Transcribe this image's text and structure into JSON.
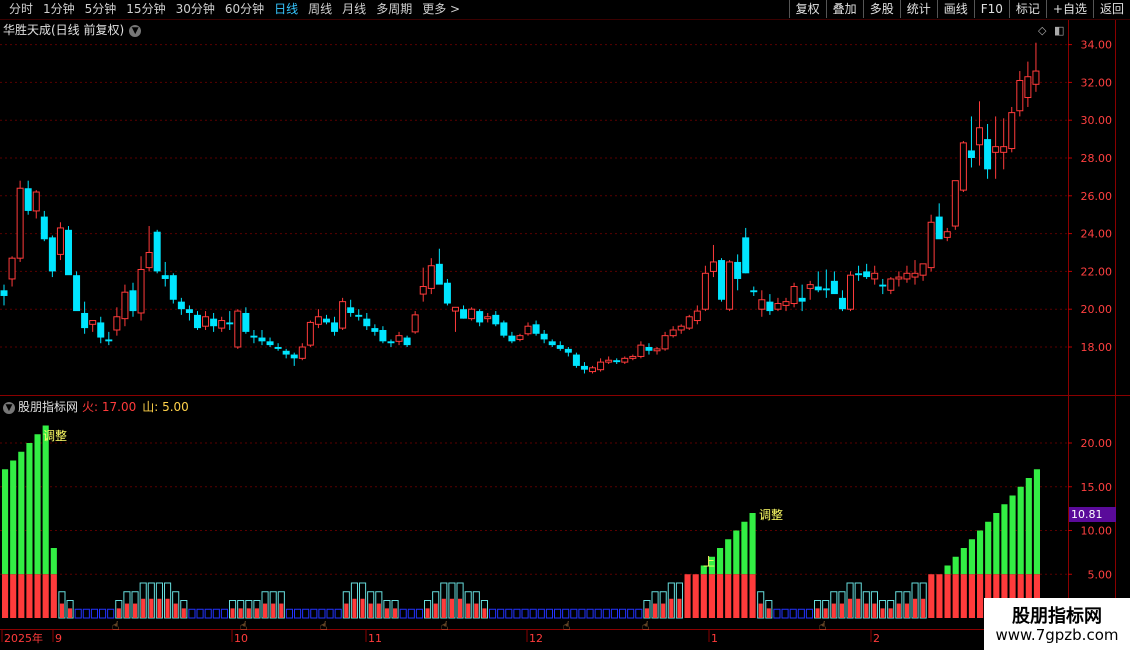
{
  "toolbar": {
    "tabs": [
      "分时",
      "1分钟",
      "5分钟",
      "15分钟",
      "30分钟",
      "60分钟",
      "日线",
      "周线",
      "月线",
      "多周期",
      "更多 >"
    ],
    "active_tab": "日线",
    "buttons": [
      "复权",
      "叠加",
      "多股",
      "统计",
      "画线",
      "F10",
      "标记",
      "+自选",
      "返回"
    ]
  },
  "chart_title": "华胜天成(日线 前复权)",
  "indicator": {
    "name": "股朋指标网",
    "param1": "火: 17.00",
    "param2": "山: 5.00",
    "labels": {
      "adjust1": "调整",
      "adjust2": "调整",
      "up": "上"
    },
    "current_value": "10.81"
  },
  "price_axis": [
    "34.00",
    "32.00",
    "30.00",
    "28.00",
    "26.00",
    "24.00",
    "22.00",
    "20.00",
    "18.00"
  ],
  "ind_axis": [
    "20.00",
    "15.00",
    "10.00",
    "5.00"
  ],
  "date_axis": [
    "2025年",
    "9",
    "10",
    "11",
    "12",
    "1",
    "2"
  ],
  "watermark": {
    "line1": "股朋指标网",
    "line2": "www.7gpzb.com"
  },
  "colors": {
    "up": "#ff3b3b",
    "down": "#00e5ff",
    "green": "#33ee44",
    "blue": "#2233ff"
  },
  "chart_data": {
    "type": "candlestick",
    "title": "华胜天成(日线 前复权)",
    "ylim": [
      16,
      35
    ],
    "candles": [
      [
        21.0,
        21.3,
        20.2,
        20.7
      ],
      [
        21.6,
        22.8,
        21.2,
        22.7
      ],
      [
        22.7,
        26.8,
        22.5,
        26.4
      ],
      [
        26.4,
        26.8,
        25.0,
        25.2
      ],
      [
        25.2,
        26.3,
        24.8,
        26.2
      ],
      [
        24.9,
        25.2,
        23.6,
        23.7
      ],
      [
        23.8,
        23.9,
        21.7,
        22.0
      ],
      [
        22.9,
        24.6,
        22.6,
        24.3
      ],
      [
        24.2,
        24.4,
        21.9,
        21.8
      ],
      [
        21.8,
        22.0,
        20.0,
        19.9
      ],
      [
        19.8,
        20.4,
        18.7,
        19.0
      ],
      [
        19.2,
        19.4,
        18.8,
        19.4
      ],
      [
        19.3,
        19.6,
        18.2,
        18.5
      ],
      [
        18.4,
        18.8,
        18.1,
        18.3
      ],
      [
        18.9,
        20.1,
        18.6,
        19.6
      ],
      [
        19.5,
        21.3,
        19.1,
        20.9
      ],
      [
        21.0,
        21.4,
        19.6,
        19.9
      ],
      [
        19.8,
        22.8,
        19.4,
        22.1
      ],
      [
        22.2,
        24.4,
        22.0,
        23.0
      ],
      [
        24.1,
        24.2,
        21.9,
        22.0
      ],
      [
        21.8,
        22.5,
        21.2,
        21.6
      ],
      [
        21.8,
        21.9,
        20.3,
        20.5
      ],
      [
        20.4,
        20.6,
        19.7,
        20.0
      ],
      [
        20.0,
        20.2,
        19.4,
        19.8
      ],
      [
        19.7,
        19.9,
        18.9,
        19.0
      ],
      [
        19.1,
        19.9,
        18.9,
        19.6
      ],
      [
        19.5,
        19.8,
        18.8,
        19.1
      ],
      [
        19.0,
        19.6,
        18.8,
        19.4
      ],
      [
        19.3,
        19.9,
        18.9,
        19.2
      ],
      [
        18.0,
        20.0,
        17.9,
        19.9
      ],
      [
        19.8,
        20.1,
        18.7,
        18.8
      ],
      [
        18.6,
        18.9,
        18.2,
        18.5
      ],
      [
        18.5,
        18.9,
        18.1,
        18.3
      ],
      [
        18.3,
        18.5,
        18.0,
        18.1
      ],
      [
        18.0,
        18.2,
        17.8,
        17.9
      ],
      [
        17.8,
        17.9,
        17.4,
        17.6
      ],
      [
        17.6,
        17.7,
        17.0,
        17.4
      ],
      [
        17.4,
        18.2,
        17.3,
        18.0
      ],
      [
        18.1,
        19.4,
        18.0,
        19.3
      ],
      [
        19.2,
        20.0,
        19.0,
        19.6
      ],
      [
        19.5,
        19.7,
        19.2,
        19.3
      ],
      [
        19.3,
        19.6,
        18.6,
        18.8
      ],
      [
        19.0,
        20.6,
        18.9,
        20.4
      ],
      [
        20.1,
        20.5,
        19.6,
        19.8
      ],
      [
        19.7,
        20.0,
        19.4,
        19.6
      ],
      [
        19.5,
        19.8,
        18.9,
        19.1
      ],
      [
        19.0,
        19.2,
        18.6,
        18.8
      ],
      [
        18.9,
        19.1,
        18.2,
        18.3
      ],
      [
        18.3,
        18.4,
        18.0,
        18.2
      ],
      [
        18.3,
        18.8,
        18.1,
        18.6
      ],
      [
        18.5,
        18.6,
        18.0,
        18.1
      ],
      [
        18.8,
        19.9,
        18.7,
        19.7
      ],
      [
        20.8,
        22.2,
        20.4,
        21.2
      ],
      [
        21.1,
        22.7,
        20.8,
        22.3
      ],
      [
        22.4,
        23.2,
        22.0,
        21.3
      ],
      [
        21.4,
        21.6,
        20.2,
        20.3
      ],
      [
        19.9,
        20.0,
        18.8,
        20.1
      ],
      [
        20.0,
        20.2,
        19.5,
        19.5
      ],
      [
        19.5,
        20.1,
        19.4,
        20.0
      ],
      [
        19.9,
        20.0,
        19.1,
        19.3
      ],
      [
        19.5,
        19.8,
        19.3,
        19.6
      ],
      [
        19.7,
        19.9,
        19.1,
        19.2
      ],
      [
        19.3,
        19.4,
        18.5,
        18.6
      ],
      [
        18.6,
        18.8,
        18.2,
        18.3
      ],
      [
        18.4,
        18.7,
        18.3,
        18.6
      ],
      [
        18.7,
        19.3,
        18.6,
        19.1
      ],
      [
        19.2,
        19.4,
        18.6,
        18.7
      ],
      [
        18.7,
        18.9,
        18.2,
        18.4
      ],
      [
        18.3,
        18.4,
        18.0,
        18.1
      ],
      [
        18.1,
        18.3,
        17.8,
        17.9
      ],
      [
        17.9,
        18.0,
        17.5,
        17.7
      ],
      [
        17.6,
        17.7,
        16.9,
        17.0
      ],
      [
        17.0,
        17.2,
        16.6,
        16.8
      ],
      [
        16.7,
        17.0,
        16.6,
        16.9
      ],
      [
        16.8,
        17.4,
        16.7,
        17.2
      ],
      [
        17.2,
        17.5,
        17.1,
        17.3
      ],
      [
        17.3,
        17.4,
        17.1,
        17.2
      ],
      [
        17.2,
        17.5,
        17.1,
        17.4
      ],
      [
        17.4,
        17.6,
        17.3,
        17.5
      ],
      [
        17.5,
        18.3,
        17.4,
        18.1
      ],
      [
        18.0,
        18.2,
        17.6,
        17.8
      ],
      [
        17.8,
        18.0,
        17.6,
        17.9
      ],
      [
        17.9,
        18.8,
        17.8,
        18.6
      ],
      [
        18.6,
        19.1,
        18.5,
        18.9
      ],
      [
        18.9,
        19.2,
        18.7,
        19.1
      ],
      [
        19.0,
        19.7,
        18.9,
        19.6
      ],
      [
        19.4,
        20.2,
        19.2,
        19.9
      ],
      [
        20.0,
        22.3,
        19.9,
        21.9
      ],
      [
        22.0,
        23.4,
        21.7,
        22.5
      ],
      [
        22.6,
        22.7,
        20.4,
        20.5
      ],
      [
        20.0,
        22.6,
        19.9,
        22.5
      ],
      [
        22.5,
        22.9,
        21.0,
        21.6
      ],
      [
        23.8,
        24.3,
        21.9,
        21.9
      ],
      [
        21.0,
        21.2,
        20.7,
        20.9
      ],
      [
        20.0,
        21.0,
        19.6,
        20.5
      ],
      [
        20.4,
        20.8,
        19.7,
        19.9
      ],
      [
        20.0,
        20.6,
        19.9,
        20.3
      ],
      [
        20.2,
        20.6,
        19.9,
        20.4
      ],
      [
        20.3,
        21.4,
        20.1,
        21.2
      ],
      [
        20.6,
        21.3,
        19.9,
        20.4
      ],
      [
        21.1,
        21.5,
        20.5,
        21.3
      ],
      [
        21.2,
        22.0,
        20.9,
        21.0
      ],
      [
        21.1,
        22.1,
        20.6,
        21.0
      ],
      [
        21.5,
        22.0,
        21.2,
        20.8
      ],
      [
        20.6,
        21.0,
        19.9,
        20.0
      ],
      [
        20.0,
        22.0,
        19.9,
        21.8
      ],
      [
        21.9,
        22.3,
        21.5,
        21.8
      ],
      [
        22.0,
        22.4,
        21.6,
        21.7
      ],
      [
        21.6,
        22.3,
        21.3,
        21.9
      ],
      [
        21.3,
        21.6,
        20.8,
        21.2
      ],
      [
        21.0,
        21.7,
        20.8,
        21.6
      ],
      [
        21.6,
        22.0,
        21.2,
        21.7
      ],
      [
        21.6,
        22.3,
        21.4,
        21.9
      ],
      [
        21.7,
        22.6,
        21.3,
        21.9
      ],
      [
        21.8,
        22.3,
        21.5,
        22.4
      ],
      [
        22.2,
        25.0,
        22.0,
        24.6
      ],
      [
        24.9,
        25.6,
        23.9,
        23.7
      ],
      [
        23.8,
        24.3,
        23.6,
        24.1
      ],
      [
        24.4,
        26.8,
        24.2,
        26.8
      ],
      [
        26.3,
        28.9,
        26.2,
        28.8
      ],
      [
        28.4,
        30.2,
        27.5,
        28.0
      ],
      [
        28.7,
        31.0,
        27.6,
        29.6
      ],
      [
        29.0,
        29.8,
        26.9,
        27.4
      ],
      [
        28.3,
        30.2,
        26.9,
        28.6
      ],
      [
        28.3,
        30.1,
        27.4,
        28.6
      ],
      [
        28.5,
        30.7,
        28.3,
        30.4
      ],
      [
        30.5,
        32.6,
        30.2,
        32.1
      ],
      [
        31.2,
        33.1,
        30.7,
        32.3
      ],
      [
        31.9,
        34.1,
        31.5,
        32.6
      ]
    ],
    "indicator_values": [
      17,
      18,
      19,
      20,
      21,
      22,
      8,
      3,
      2,
      1,
      1,
      1,
      1,
      1,
      2,
      3,
      3,
      4,
      4,
      4,
      4,
      3,
      2,
      1,
      1,
      1,
      1,
      1,
      2,
      2,
      2,
      2,
      3,
      3,
      3,
      1,
      1,
      1,
      1,
      1,
      1,
      1,
      3,
      4,
      4,
      3,
      3,
      2,
      2,
      1,
      1,
      1,
      2,
      3,
      4,
      4,
      4,
      3,
      3,
      2,
      1,
      1,
      1,
      1,
      1,
      1,
      1,
      1,
      1,
      1,
      1,
      1,
      1,
      1,
      1,
      1,
      1,
      1,
      1,
      2,
      3,
      3,
      4,
      4,
      5,
      5,
      6,
      7,
      8,
      9,
      10,
      11,
      12,
      3,
      2,
      1,
      1,
      1,
      1,
      1,
      2,
      2,
      3,
      3,
      4,
      4,
      3,
      3,
      2,
      2,
      3,
      3,
      4,
      4,
      5,
      5,
      6,
      7,
      8,
      9,
      10,
      11,
      12,
      13,
      14,
      15,
      16,
      17
    ]
  }
}
